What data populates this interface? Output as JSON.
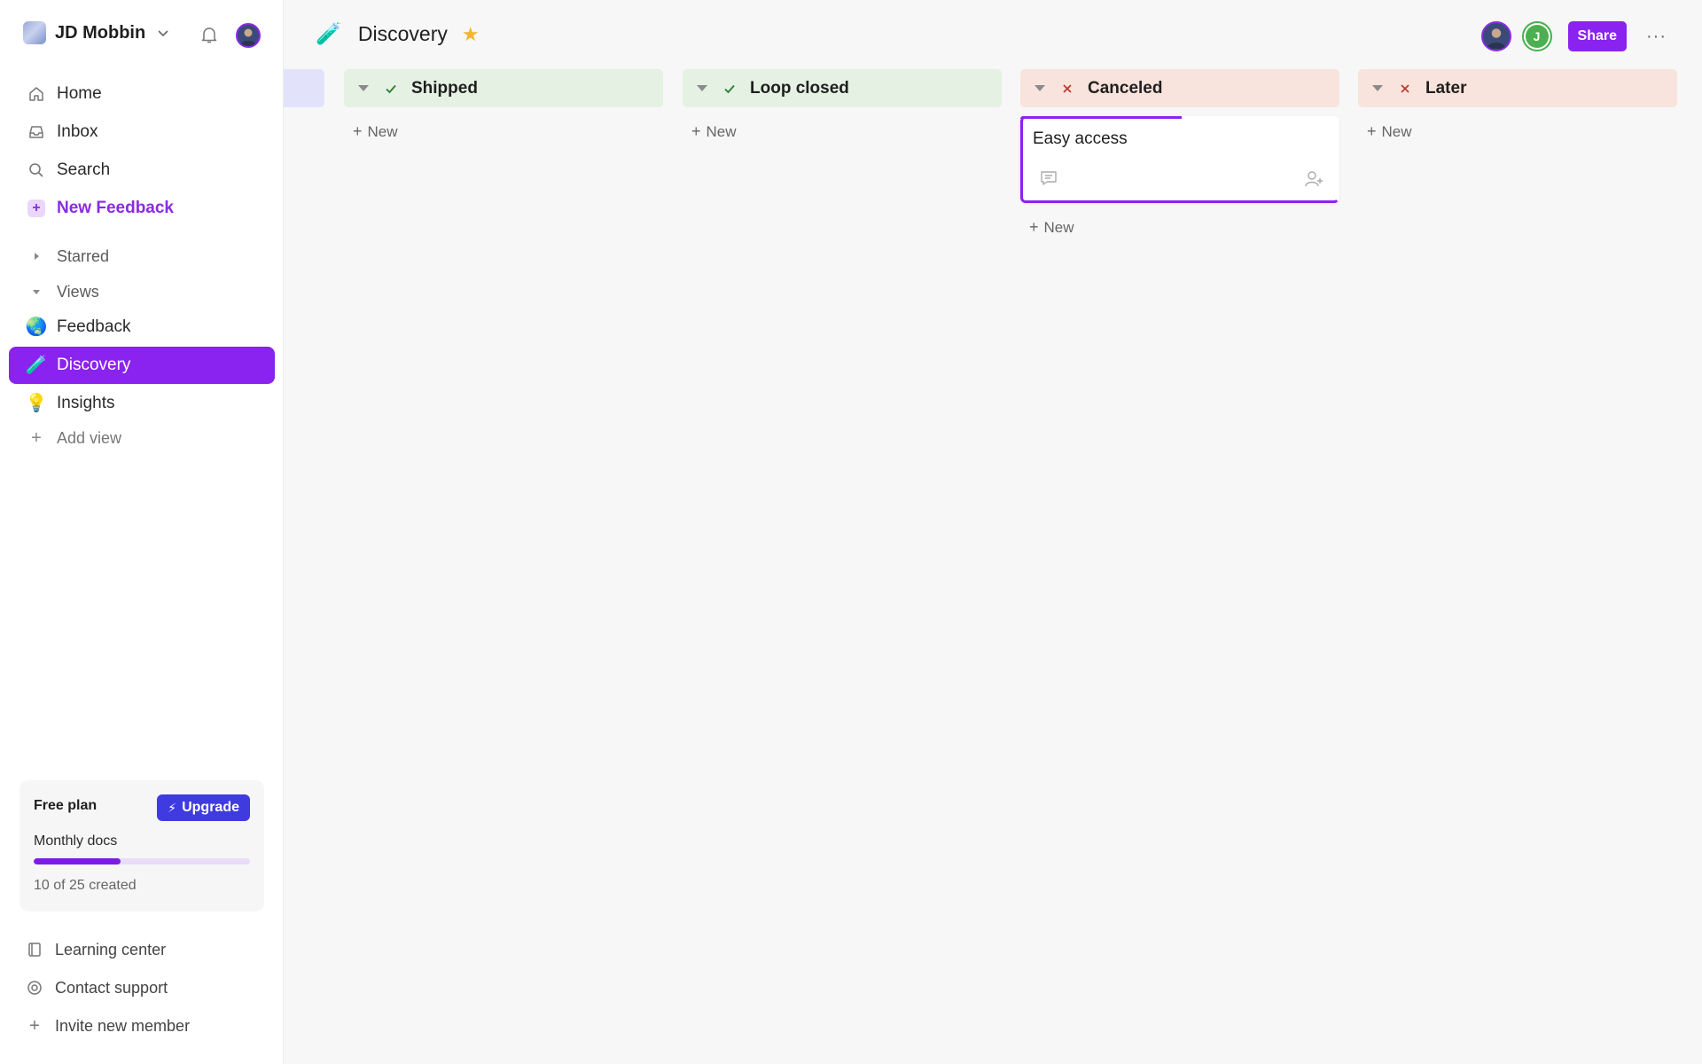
{
  "workspace": {
    "name": "JD Mobbin",
    "logo_icon": "workspace-logo-icon"
  },
  "nav": {
    "home": "Home",
    "inbox": "Inbox",
    "search": "Search",
    "new_feedback": "New Feedback",
    "starred": "Starred",
    "views": "Views",
    "view_items": [
      {
        "label": "Feedback",
        "emoji": "🌏"
      },
      {
        "label": "Discovery",
        "emoji": "🧪"
      },
      {
        "label": "Insights",
        "emoji": "💡"
      }
    ],
    "add_view": "Add view"
  },
  "plan": {
    "title": "Free plan",
    "upgrade_label": "Upgrade",
    "metric_label": "Monthly docs",
    "used": 10,
    "limit": 25,
    "created_text": "10 of 25 created"
  },
  "footer": {
    "learning": "Learning center",
    "support": "Contact support",
    "invite": "Invite new member"
  },
  "page": {
    "title": "Discovery",
    "emoji": "🧪",
    "share_label": "Share",
    "avatar_initial": "J"
  },
  "columns": [
    {
      "title": "Shipped",
      "status": "done",
      "color": "#e4f1e3",
      "new_label": "New",
      "cards": []
    },
    {
      "title": "Loop closed",
      "status": "done",
      "color": "#e4f1e3",
      "new_label": "New",
      "cards": []
    },
    {
      "title": "Canceled",
      "status": "canceled",
      "color": "#f9e4dd",
      "new_label": "New",
      "cards": [
        {
          "title": "Easy access"
        }
      ]
    },
    {
      "title": "Later",
      "status": "canceled",
      "color": "#f9e4dd",
      "new_label": "New",
      "cards": []
    }
  ],
  "colors": {
    "accent": "#8a22f0",
    "upgrade": "#3f3be0",
    "star": "#f2b632",
    "check": "#2e7d32",
    "cross": "#c0392b"
  }
}
